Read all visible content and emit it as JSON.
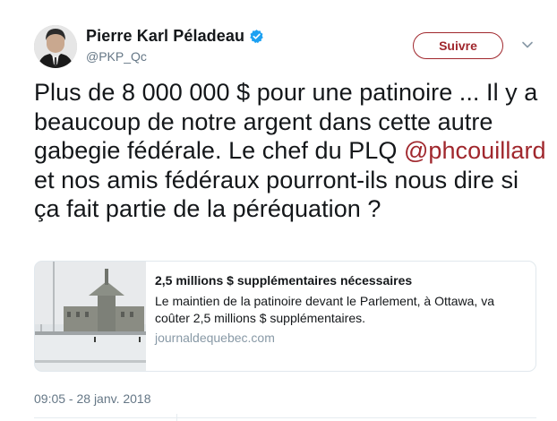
{
  "author": {
    "display_name": "Pierre Karl Péladeau",
    "handle": "@PKP_Qc",
    "verified_icon": "verified-badge-icon",
    "avatar_icon": "avatar"
  },
  "actions": {
    "follow_label": "Suivre",
    "more_icon": "chevron-down-icon"
  },
  "tweet": {
    "text_part1": "Plus de 8 000 000 $ pour une patinoire ... Il y a beaucoup de notre argent dans cette autre gabegie fédérale.  Le chef du PLQ ",
    "mention": "@phcouillard",
    "text_part2": "  et nos amis fédéraux pourront-ils nous dire si ça fait partie de la péréquation ?"
  },
  "card": {
    "title": "2,5 millions $ supplémentaires nécessaires",
    "description": "Le maintien de la patinoire devant le Parlement, à Ottawa, va coûter 2,5 millions $ supplémentaires.",
    "domain": "journaldequebec.com"
  },
  "timestamp": "09:05 - 28 janv. 2018",
  "colors": {
    "accent": "#a0272d",
    "verified": "#1da1f2",
    "muted": "#657786"
  }
}
